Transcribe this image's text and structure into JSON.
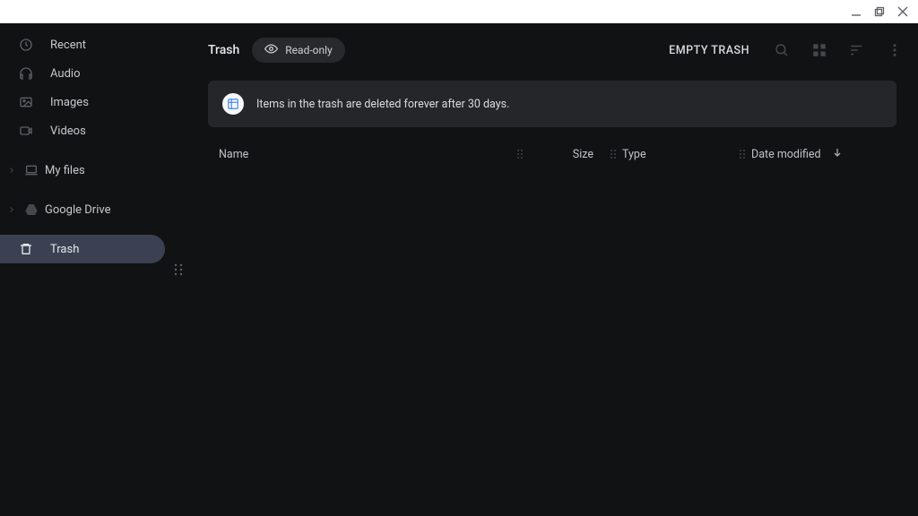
{
  "sidebar": {
    "items": [
      {
        "label": "Recent"
      },
      {
        "label": "Audio"
      },
      {
        "label": "Images"
      },
      {
        "label": "Videos"
      },
      {
        "label": "My files"
      },
      {
        "label": "Google Drive"
      },
      {
        "label": "Trash"
      }
    ]
  },
  "header": {
    "title": "Trash",
    "readonly_label": "Read-only",
    "empty_action": "EMPTY TRASH"
  },
  "banner": {
    "text": "Items in the trash are deleted forever after 30 days."
  },
  "columns": {
    "name": "Name",
    "size": "Size",
    "type": "Type",
    "date": "Date modified"
  }
}
